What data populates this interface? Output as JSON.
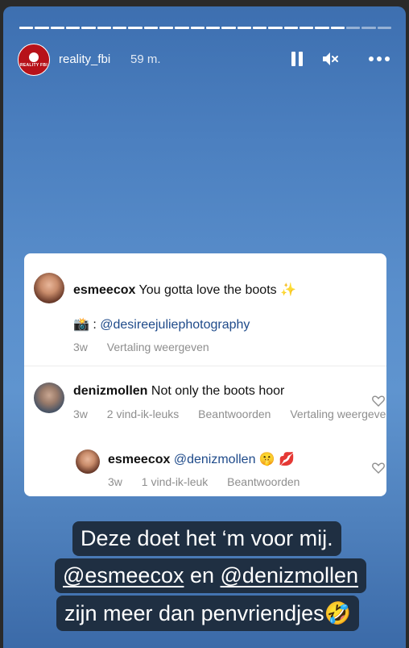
{
  "story": {
    "progress_segments": 24,
    "progress_done": 21,
    "username": "reality_fbi",
    "time": "59 m.",
    "avatar_logo_text": "REALITY FBI"
  },
  "comments": [
    {
      "user": "esmeecox",
      "text": "You gotta love the boots ✨",
      "line2_prefix": "📸 : ",
      "line2_mention": "@desireejuliephotography",
      "meta": [
        "3w",
        "Vertaling weergeven"
      ]
    },
    {
      "user": "denizmollen",
      "text": "Not only the boots hoor",
      "meta": [
        "3w",
        "2 vind-ik-leuks",
        "Beantwoorden",
        "Vertaling weergeven"
      ]
    },
    {
      "user": "esmeecox",
      "mention": "@denizmollen",
      "emoji": "🤫 💋",
      "meta": [
        "3w",
        "1 vind-ik-leuk",
        "Beantwoorden"
      ]
    }
  ],
  "caption": {
    "line1": "Deze doet het ‘m voor mij.",
    "line2_a": "@esmeecox",
    "line2_b": " en ",
    "line2_c": "@denizmollen",
    "line3": "zijn meer dan penvriendjes🤣"
  },
  "colors": {
    "story_bg": "#4b7fbf",
    "caption_bg": "#1f2f42",
    "avatar_bg": "#b7121a",
    "mention": "#1e4a8a"
  }
}
